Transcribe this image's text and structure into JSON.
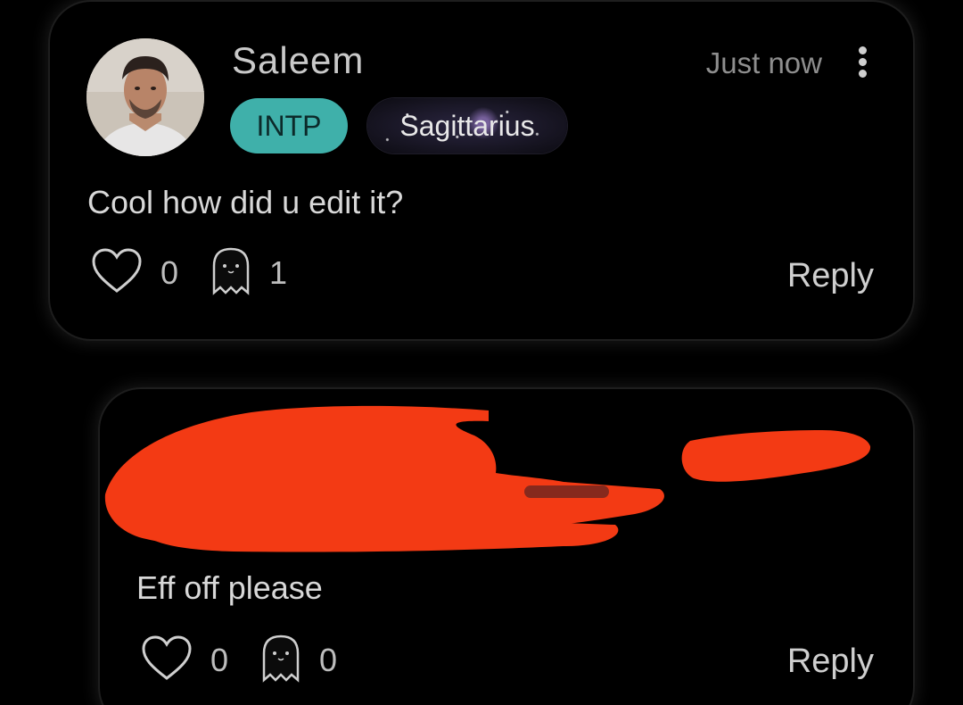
{
  "comments": [
    {
      "username": "Saleem",
      "timestamp": "Just now",
      "mbti": "INTP",
      "zodiac": "Sagittarius",
      "text": "Cool how did u edit it?",
      "likes": "0",
      "ghosts": "1",
      "reply_label": "Reply"
    },
    {
      "text": "Eff off please",
      "likes": "0",
      "ghosts": "0",
      "reply_label": "Reply"
    }
  ],
  "colors": {
    "mbti_badge": "#3fb0aa",
    "redaction": "#f33a14",
    "background": "#000000"
  },
  "icons": {
    "like": "heart-icon",
    "ghost": "ghost-icon",
    "menu": "more-vertical-icon"
  }
}
